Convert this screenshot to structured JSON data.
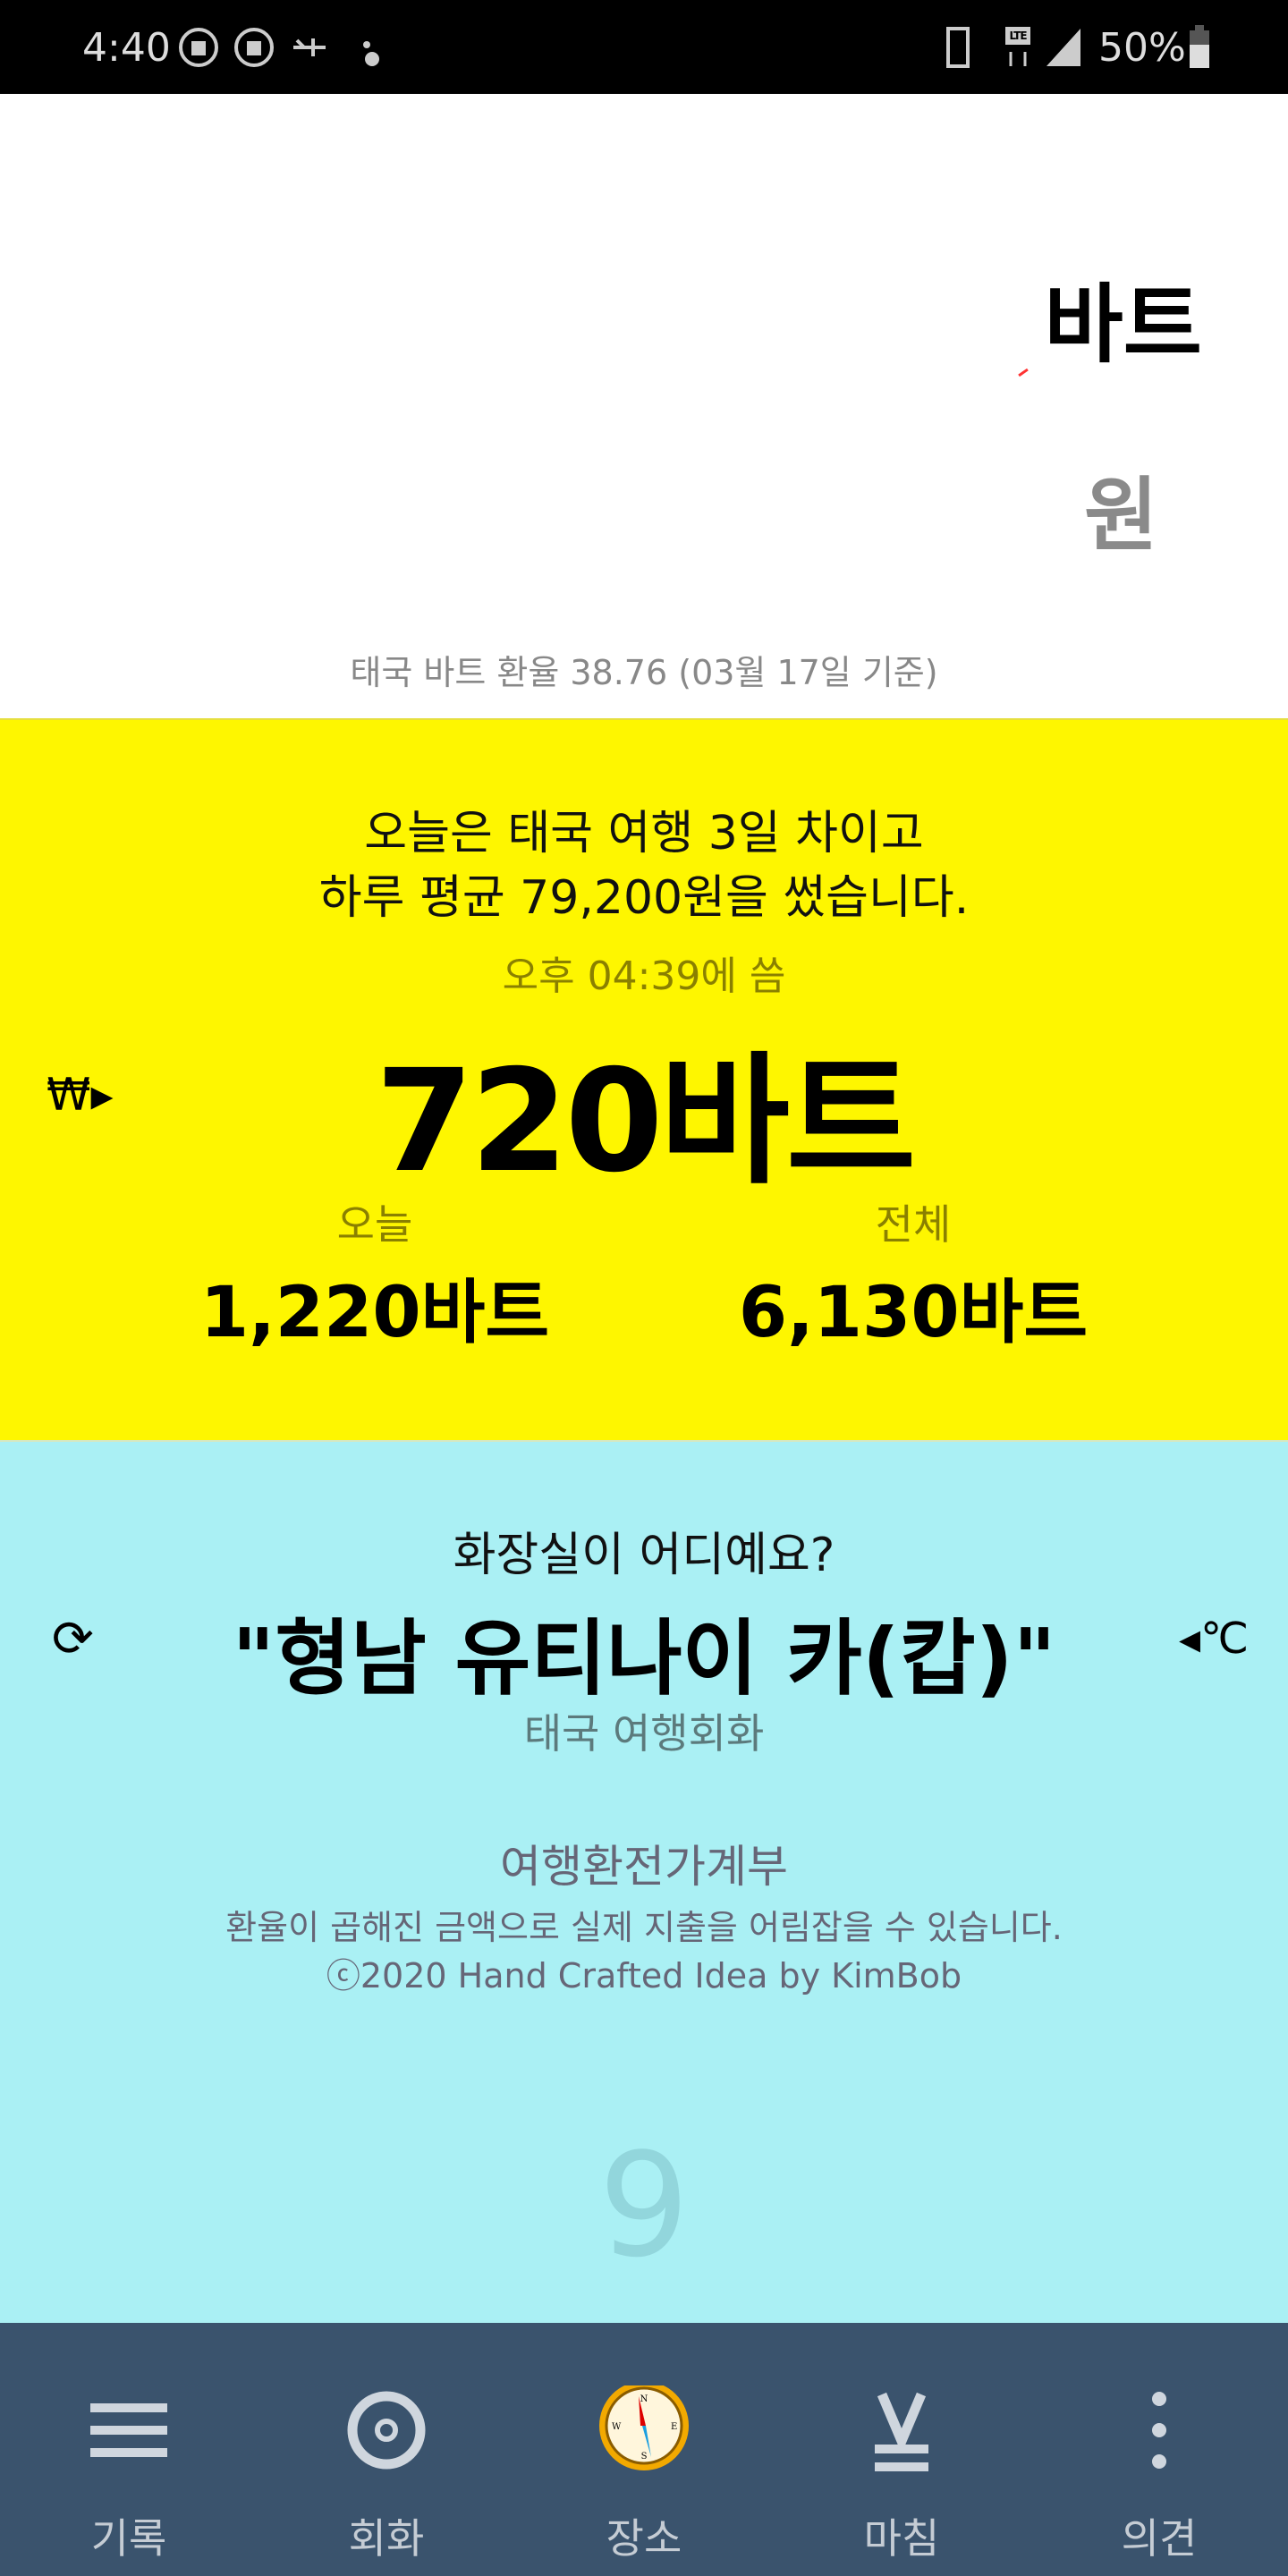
{
  "status_bar": {
    "time": "4:40",
    "battery": "50%",
    "network": "LTE"
  },
  "converter": {
    "foreign_unit": "바트",
    "home_unit": "원",
    "rate_note": "태국 바트 환율 38.76 (03월 17일 기준)"
  },
  "summary": {
    "line1": "오늘은 태국 여행 3일 차이고",
    "line2": "하루 평균 79,200원을 썼습니다.",
    "last_time": "오후 04:39에 씀",
    "last_amount": "720바트",
    "currency_toggle": "₩▸",
    "today_label": "오늘",
    "today_value": "1,220바트",
    "total_label": "전체",
    "total_value": "6,130바트"
  },
  "phrase": {
    "question": "화장실이 어디예요?",
    "answer": "\"형남 유티나이 카(캅)\"",
    "category": "태국 여행회화",
    "refresh_icon": "⟳",
    "weather_toggle": "◂℃"
  },
  "about": {
    "title": "여행환전가계부",
    "desc": "환율이 곱해진 금액으로 실제 지출을 어림잡을 수 있습니다.",
    "credit": "ⓒ2020 Hand Crafted Idea by KimBob",
    "counter": "9"
  },
  "nav": [
    {
      "label": "기록",
      "icon": "menu-icon"
    },
    {
      "label": "회화",
      "icon": "target-icon"
    },
    {
      "label": "장소",
      "icon": "compass-icon"
    },
    {
      "label": "마침",
      "icon": "finish-icon"
    },
    {
      "label": "의견",
      "icon": "more-vertical-icon"
    }
  ],
  "colors": {
    "yellow": "#fef600",
    "cyan": "#aaf0f4",
    "nav": "#3a536d"
  }
}
